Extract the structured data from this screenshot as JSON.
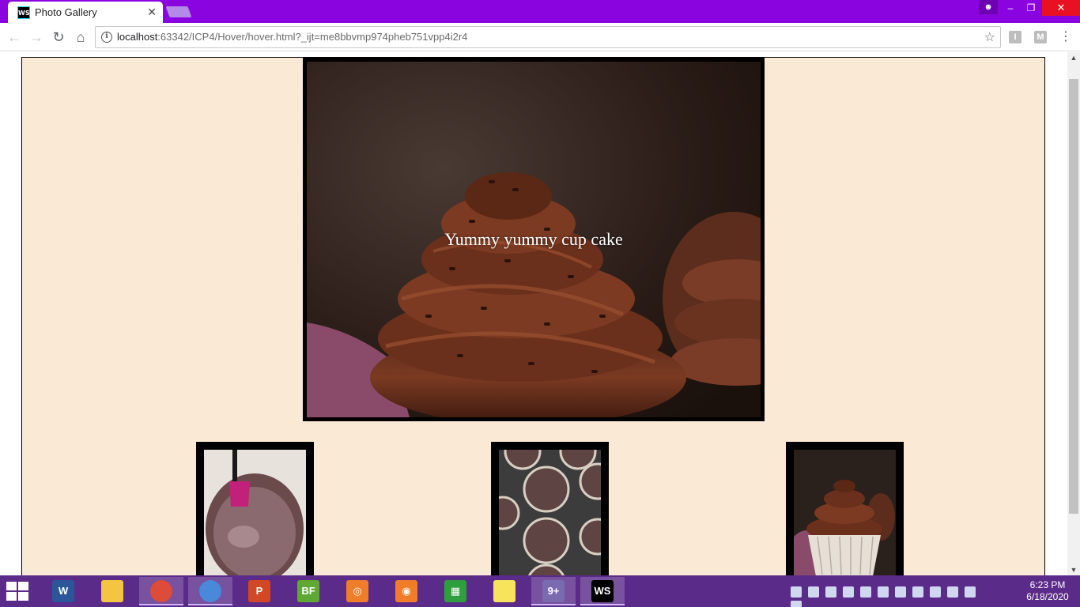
{
  "browser": {
    "tab_title": "Photo Gallery",
    "tab_favicon": "WS",
    "tab_close": "✕",
    "url_host": "localhost",
    "url_rest": ":63342/ICP4/Hover/hover.html?_ijt=me8bbvmp974pheb751vpp4i2r4",
    "extensions": [
      "I",
      "M"
    ]
  },
  "window": {
    "min": "–",
    "max": "❐",
    "close": "✕"
  },
  "gallery": {
    "main_caption": "Yummy yummy cup cake",
    "thumbnails": [
      "chocolate-batter-bowl-photo",
      "cupcake-tin-photo",
      "frosted-cupcake-photo"
    ]
  },
  "taskbar": {
    "apps": [
      {
        "name": "word",
        "glyph": "W",
        "color": "#2b579a"
      },
      {
        "name": "file-explorer",
        "glyph": "",
        "color": "#f4c542"
      },
      {
        "name": "chrome",
        "glyph": "",
        "color": "#dd4b39"
      },
      {
        "name": "chromium",
        "glyph": "",
        "color": "#4a88d9"
      },
      {
        "name": "powerpoint",
        "glyph": "P",
        "color": "#d24726"
      },
      {
        "name": "big-farm",
        "glyph": "BF",
        "color": "#5fa832"
      },
      {
        "name": "app-orange",
        "glyph": "◎",
        "color": "#f07d2a"
      },
      {
        "name": "camera",
        "glyph": "◉",
        "color": "#f07d2a"
      },
      {
        "name": "store",
        "glyph": "▦",
        "color": "#2e9e3e"
      },
      {
        "name": "sticky-notes",
        "glyph": "",
        "color": "#f8e45c"
      },
      {
        "name": "notifications-app",
        "glyph": "9+",
        "color": "#7a6ab0"
      },
      {
        "name": "webstorm",
        "glyph": "WS",
        "color": "#000000"
      }
    ],
    "clock_time": "6:23 PM",
    "clock_date": "6/18/2020"
  },
  "colors": {
    "titlebar": "#8a04e0",
    "page_background": "#fae9d5",
    "taskbar": "#5b2b8a"
  }
}
